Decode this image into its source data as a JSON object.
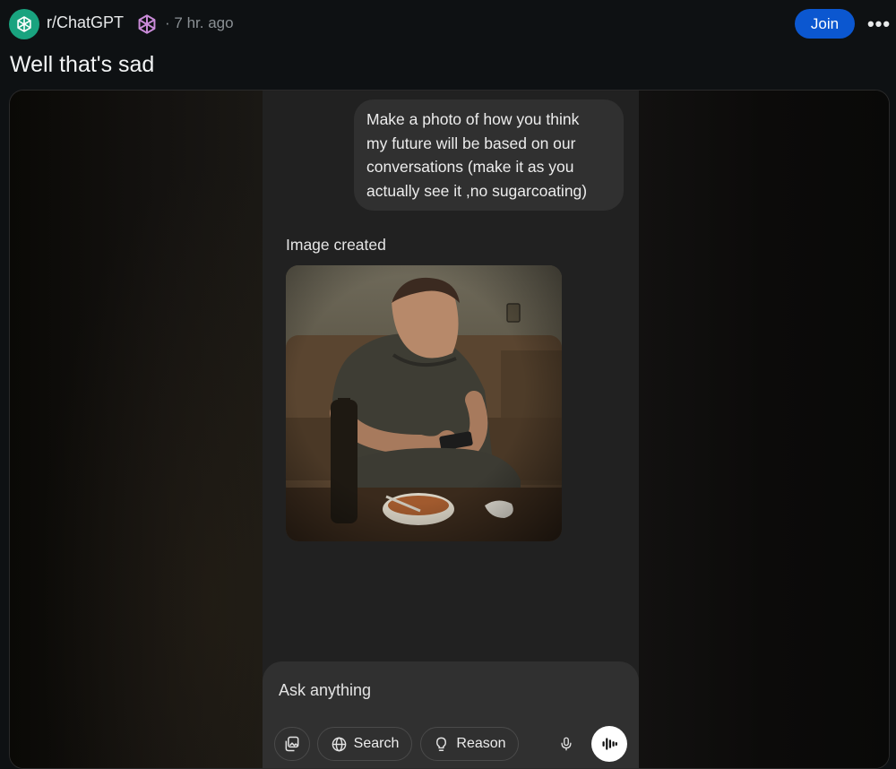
{
  "header": {
    "subreddit": "r/ChatGPT",
    "separator": "·",
    "time_ago": "7 hr. ago",
    "join_label": "Join",
    "more_label": "•••",
    "avatar_icon": "openai-logo-icon",
    "flair_icon": "openai-logo-icon"
  },
  "post": {
    "title": "Well that's sad"
  },
  "chat": {
    "user_message_lines": [
      "Make a photo of how you think",
      "my future will be based on our",
      "conversations (make it as you",
      "actually see it ,no sugarcoating)"
    ],
    "image_created_label": "Image created",
    "generated_image": "photo-man-sitting-on-couch-with-phone-bottle-and-bowl"
  },
  "composer": {
    "placeholder": "Ask anything",
    "attach_icon": "image-attach-icon",
    "search_label": "Search",
    "search_icon": "globe-icon",
    "reason_label": "Reason",
    "reason_icon": "lightbulb-icon",
    "mic_icon": "microphone-icon",
    "voice_icon": "voice-mode-icon"
  },
  "colors": {
    "page_bg": "#0e1113",
    "join_button": "#0b57d0",
    "subreddit_avatar": "#19a37f",
    "chat_bg": "#212121",
    "bubble_bg": "#303030"
  }
}
